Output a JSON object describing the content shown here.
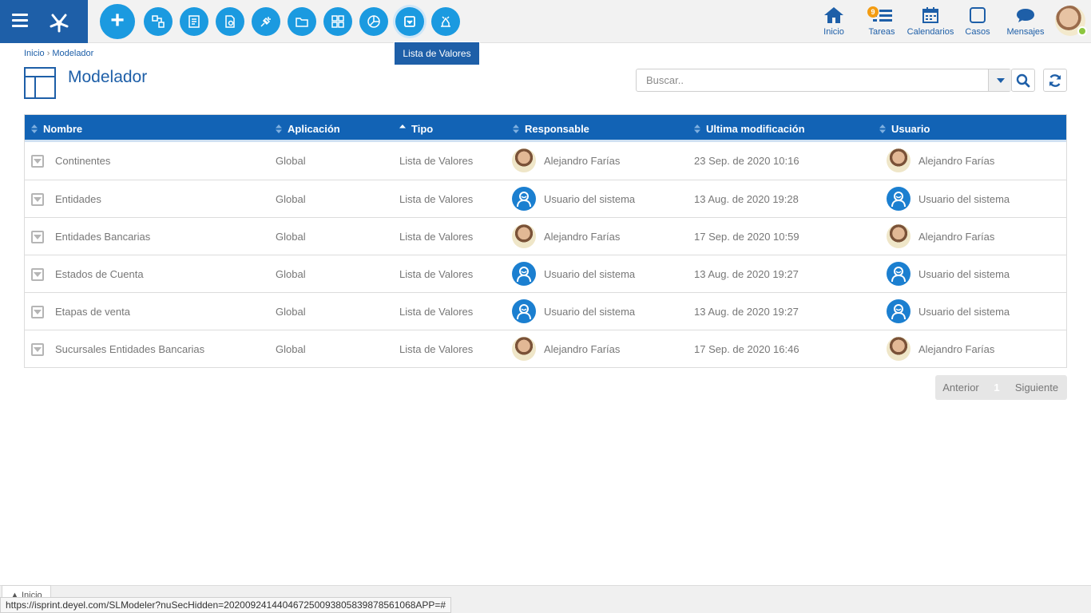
{
  "topbar": {
    "tooltip": "Lista de Valores",
    "nav": {
      "inicio": "Inicio",
      "tareas": "Tareas",
      "tareas_badge": "9",
      "calendarios": "Calendarios",
      "casos": "Casos",
      "mensajes": "Mensajes"
    }
  },
  "breadcrumb": {
    "home": "Inicio",
    "current": "Modelador"
  },
  "page": {
    "title": "Modelador"
  },
  "search": {
    "placeholder": "Buscar.."
  },
  "table": {
    "headers": {
      "nombre": "Nombre",
      "aplicacion": "Aplicación",
      "tipo": "Tipo",
      "responsable": "Responsable",
      "ultima": "Ultima modificación",
      "usuario": "Usuario"
    },
    "rows": [
      {
        "nombre": "Continentes",
        "aplicacion": "Global",
        "tipo": "Lista de Valores",
        "responsable": "Alejandro Farías",
        "responsable_avatar": "photo",
        "ultima": "23 Sep. de 2020 10:16",
        "usuario": "Alejandro Farías",
        "usuario_avatar": "photo"
      },
      {
        "nombre": "Entidades",
        "aplicacion": "Global",
        "tipo": "Lista de Valores",
        "responsable": "Usuario del sistema",
        "responsable_avatar": "system",
        "ultima": "13 Aug. de 2020 19:28",
        "usuario": "Usuario del sistema",
        "usuario_avatar": "system"
      },
      {
        "nombre": "Entidades Bancarias",
        "aplicacion": "Global",
        "tipo": "Lista de Valores",
        "responsable": "Alejandro Farías",
        "responsable_avatar": "photo",
        "ultima": "17 Sep. de 2020 10:59",
        "usuario": "Alejandro Farías",
        "usuario_avatar": "photo"
      },
      {
        "nombre": "Estados de Cuenta",
        "aplicacion": "Global",
        "tipo": "Lista de Valores",
        "responsable": "Usuario del sistema",
        "responsable_avatar": "system",
        "ultima": "13 Aug. de 2020 19:27",
        "usuario": "Usuario del sistema",
        "usuario_avatar": "system"
      },
      {
        "nombre": "Etapas de venta",
        "aplicacion": "Global",
        "tipo": "Lista de Valores",
        "responsable": "Usuario del sistema",
        "responsable_avatar": "system",
        "ultima": "13 Aug. de 2020 19:27",
        "usuario": "Usuario del sistema",
        "usuario_avatar": "system"
      },
      {
        "nombre": "Sucursales Entidades Bancarias",
        "aplicacion": "Global",
        "tipo": "Lista de Valores",
        "responsable": "Alejandro Farías",
        "responsable_avatar": "photo",
        "ultima": "17 Sep. de 2020 16:46",
        "usuario": "Alejandro Farías",
        "usuario_avatar": "photo"
      }
    ]
  },
  "pager": {
    "prev": "Anterior",
    "page": "1",
    "next": "Siguiente"
  },
  "footer": {
    "home_tab": "Inicio",
    "status_url": "https://isprint.deyel.com/SLModeler?nuSecHidden=202009241440467250093805839878561068APP=#"
  },
  "colors": {
    "brand": "#1e5fa8",
    "accent": "#1b9ae0",
    "header": "#1263b5"
  }
}
